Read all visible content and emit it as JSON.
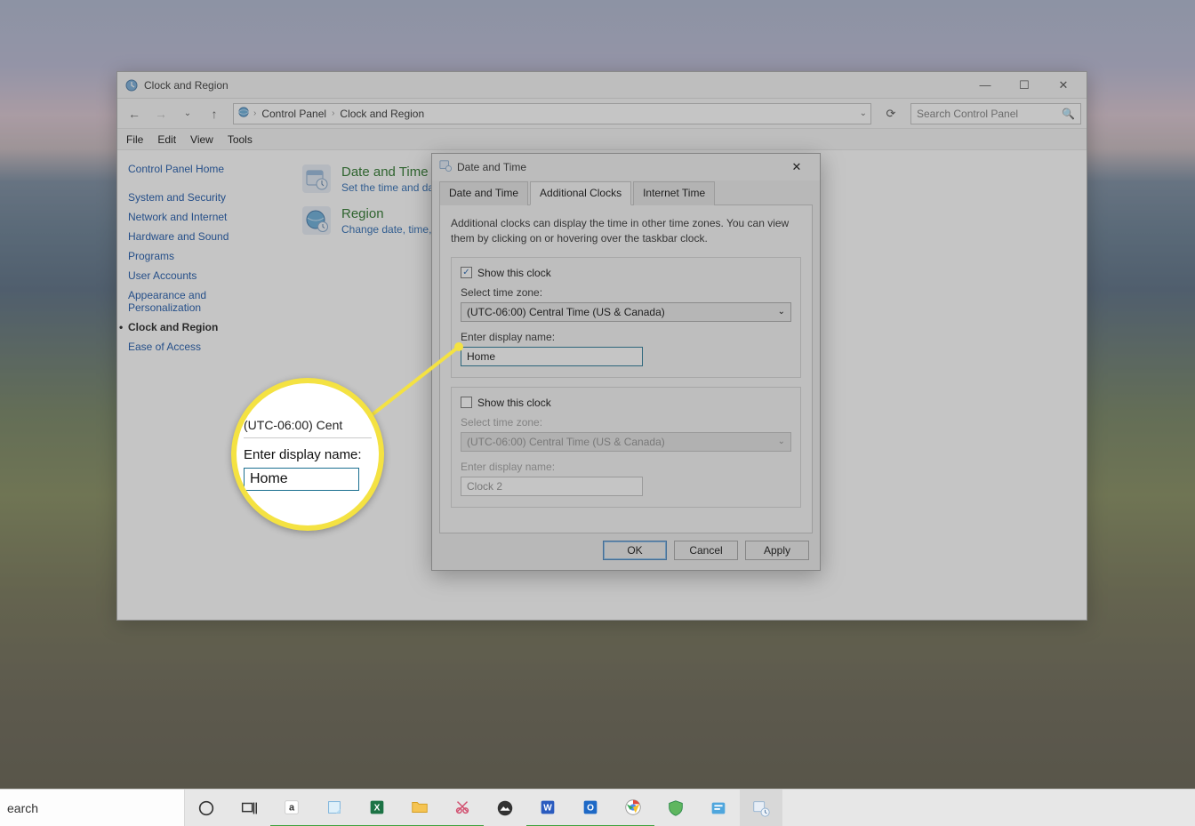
{
  "cp": {
    "title": "Clock and Region",
    "breadcrumb": {
      "root": "Control Panel",
      "leaf": "Clock and Region"
    },
    "search_placeholder": "Search Control Panel",
    "menus": {
      "file": "File",
      "edit": "Edit",
      "view": "View",
      "tools": "Tools"
    },
    "sidebar": {
      "home": "Control Panel Home",
      "items": [
        "System and Security",
        "Network and Internet",
        "Hardware and Sound",
        "Programs",
        "User Accounts",
        "Appearance and Personalization",
        "Clock and Region",
        "Ease of Access"
      ],
      "active_index": 6
    },
    "content": {
      "date_time": {
        "title": "Date and Time",
        "sub": "Set the time and date"
      },
      "region": {
        "title": "Region",
        "sub": "Change date, time, or number formats"
      }
    }
  },
  "dialog": {
    "title": "Date and Time",
    "tabs": {
      "t1": "Date and Time",
      "t2": "Additional Clocks",
      "t3": "Internet Time"
    },
    "active_tab": "t2",
    "desc": "Additional clocks can display the time in other time zones. You can view them by clicking on or hovering over the taskbar clock.",
    "show_clock_label": "Show this clock",
    "select_tz_label": "Select time zone:",
    "enter_name_label": "Enter display name:",
    "clock1": {
      "checked": true,
      "timezone": "(UTC-06:00) Central Time (US & Canada)",
      "name": "Home"
    },
    "clock2": {
      "checked": false,
      "timezone": "(UTC-06:00) Central Time (US & Canada)",
      "name": "Clock 2"
    },
    "buttons": {
      "ok": "OK",
      "cancel": "Cancel",
      "apply": "Apply"
    }
  },
  "magnifier": {
    "tz_fragment": "(UTC-06:00) Cent",
    "label": "Enter display name:",
    "value": "Home"
  },
  "taskbar": {
    "search_placeholder": "earch"
  }
}
